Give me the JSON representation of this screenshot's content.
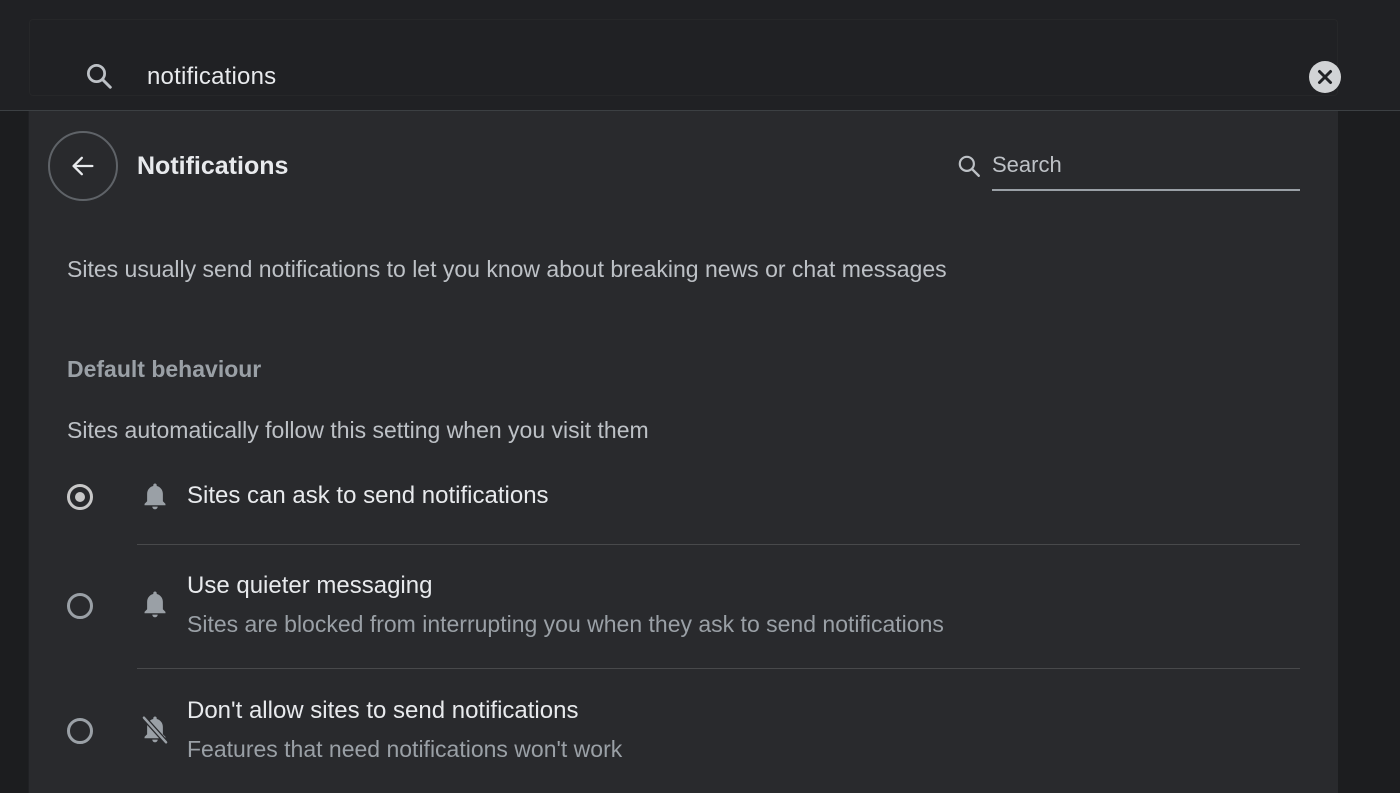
{
  "search": {
    "query": "notifications"
  },
  "page": {
    "title": "Notifications",
    "search_placeholder": "Search",
    "description": "Sites usually send notifications to let you know about breaking news or chat messages"
  },
  "default_behaviour": {
    "heading": "Default behaviour",
    "subtitle": "Sites automatically follow this setting when you visit them",
    "options": [
      {
        "label": "Sites can ask to send notifications",
        "description": "",
        "selected": true,
        "icon": "bell-icon"
      },
      {
        "label": "Use quieter messaging",
        "description": "Sites are blocked from interrupting you when they ask to send notifications",
        "selected": false,
        "icon": "bell-icon"
      },
      {
        "label": "Don't allow sites to send notifications",
        "description": "Features that need notifications won't work",
        "selected": false,
        "icon": "bell-off-icon"
      }
    ]
  },
  "colors": {
    "background": "#202124",
    "card": "#292a2d",
    "text_primary": "#e8eaed",
    "text_secondary": "#9aa0a6"
  }
}
